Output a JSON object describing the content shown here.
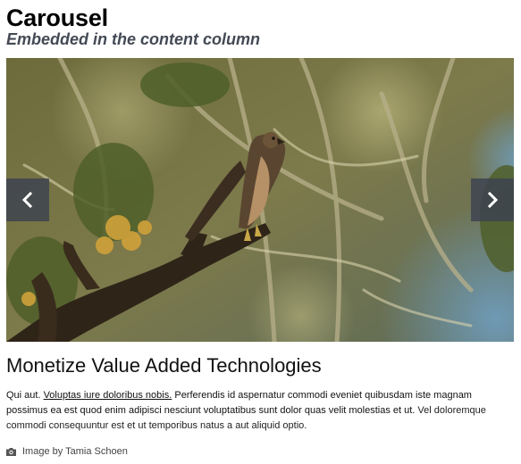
{
  "header": {
    "title": "Carousel",
    "subtitle": "Embedded in the content column"
  },
  "carousel": {
    "prev_icon": "chevron-left-icon",
    "next_icon": "chevron-right-icon",
    "colors": {
      "nav_bg": "#3c4250",
      "nav_fg": "#ffffff"
    }
  },
  "slide": {
    "title": "Monetize Value Added Technologies",
    "body_lead": "Qui aut. ",
    "body_link": "Voluptas iure doloribus nobis.",
    "body_main": " Perferendis id aspernatur commodi eveniet quibusdam iste magnam possimus ea est quod enim adipisci nesciunt voluptatibus sunt dolor quas velit molestias et ut. ",
    "body_tail": "Vel doloremque commodi consequuntur est et ut temporibus natus a aut aliquid optio.",
    "credit_icon": "camera-icon",
    "credit": "Image by Tamia Schoen"
  }
}
